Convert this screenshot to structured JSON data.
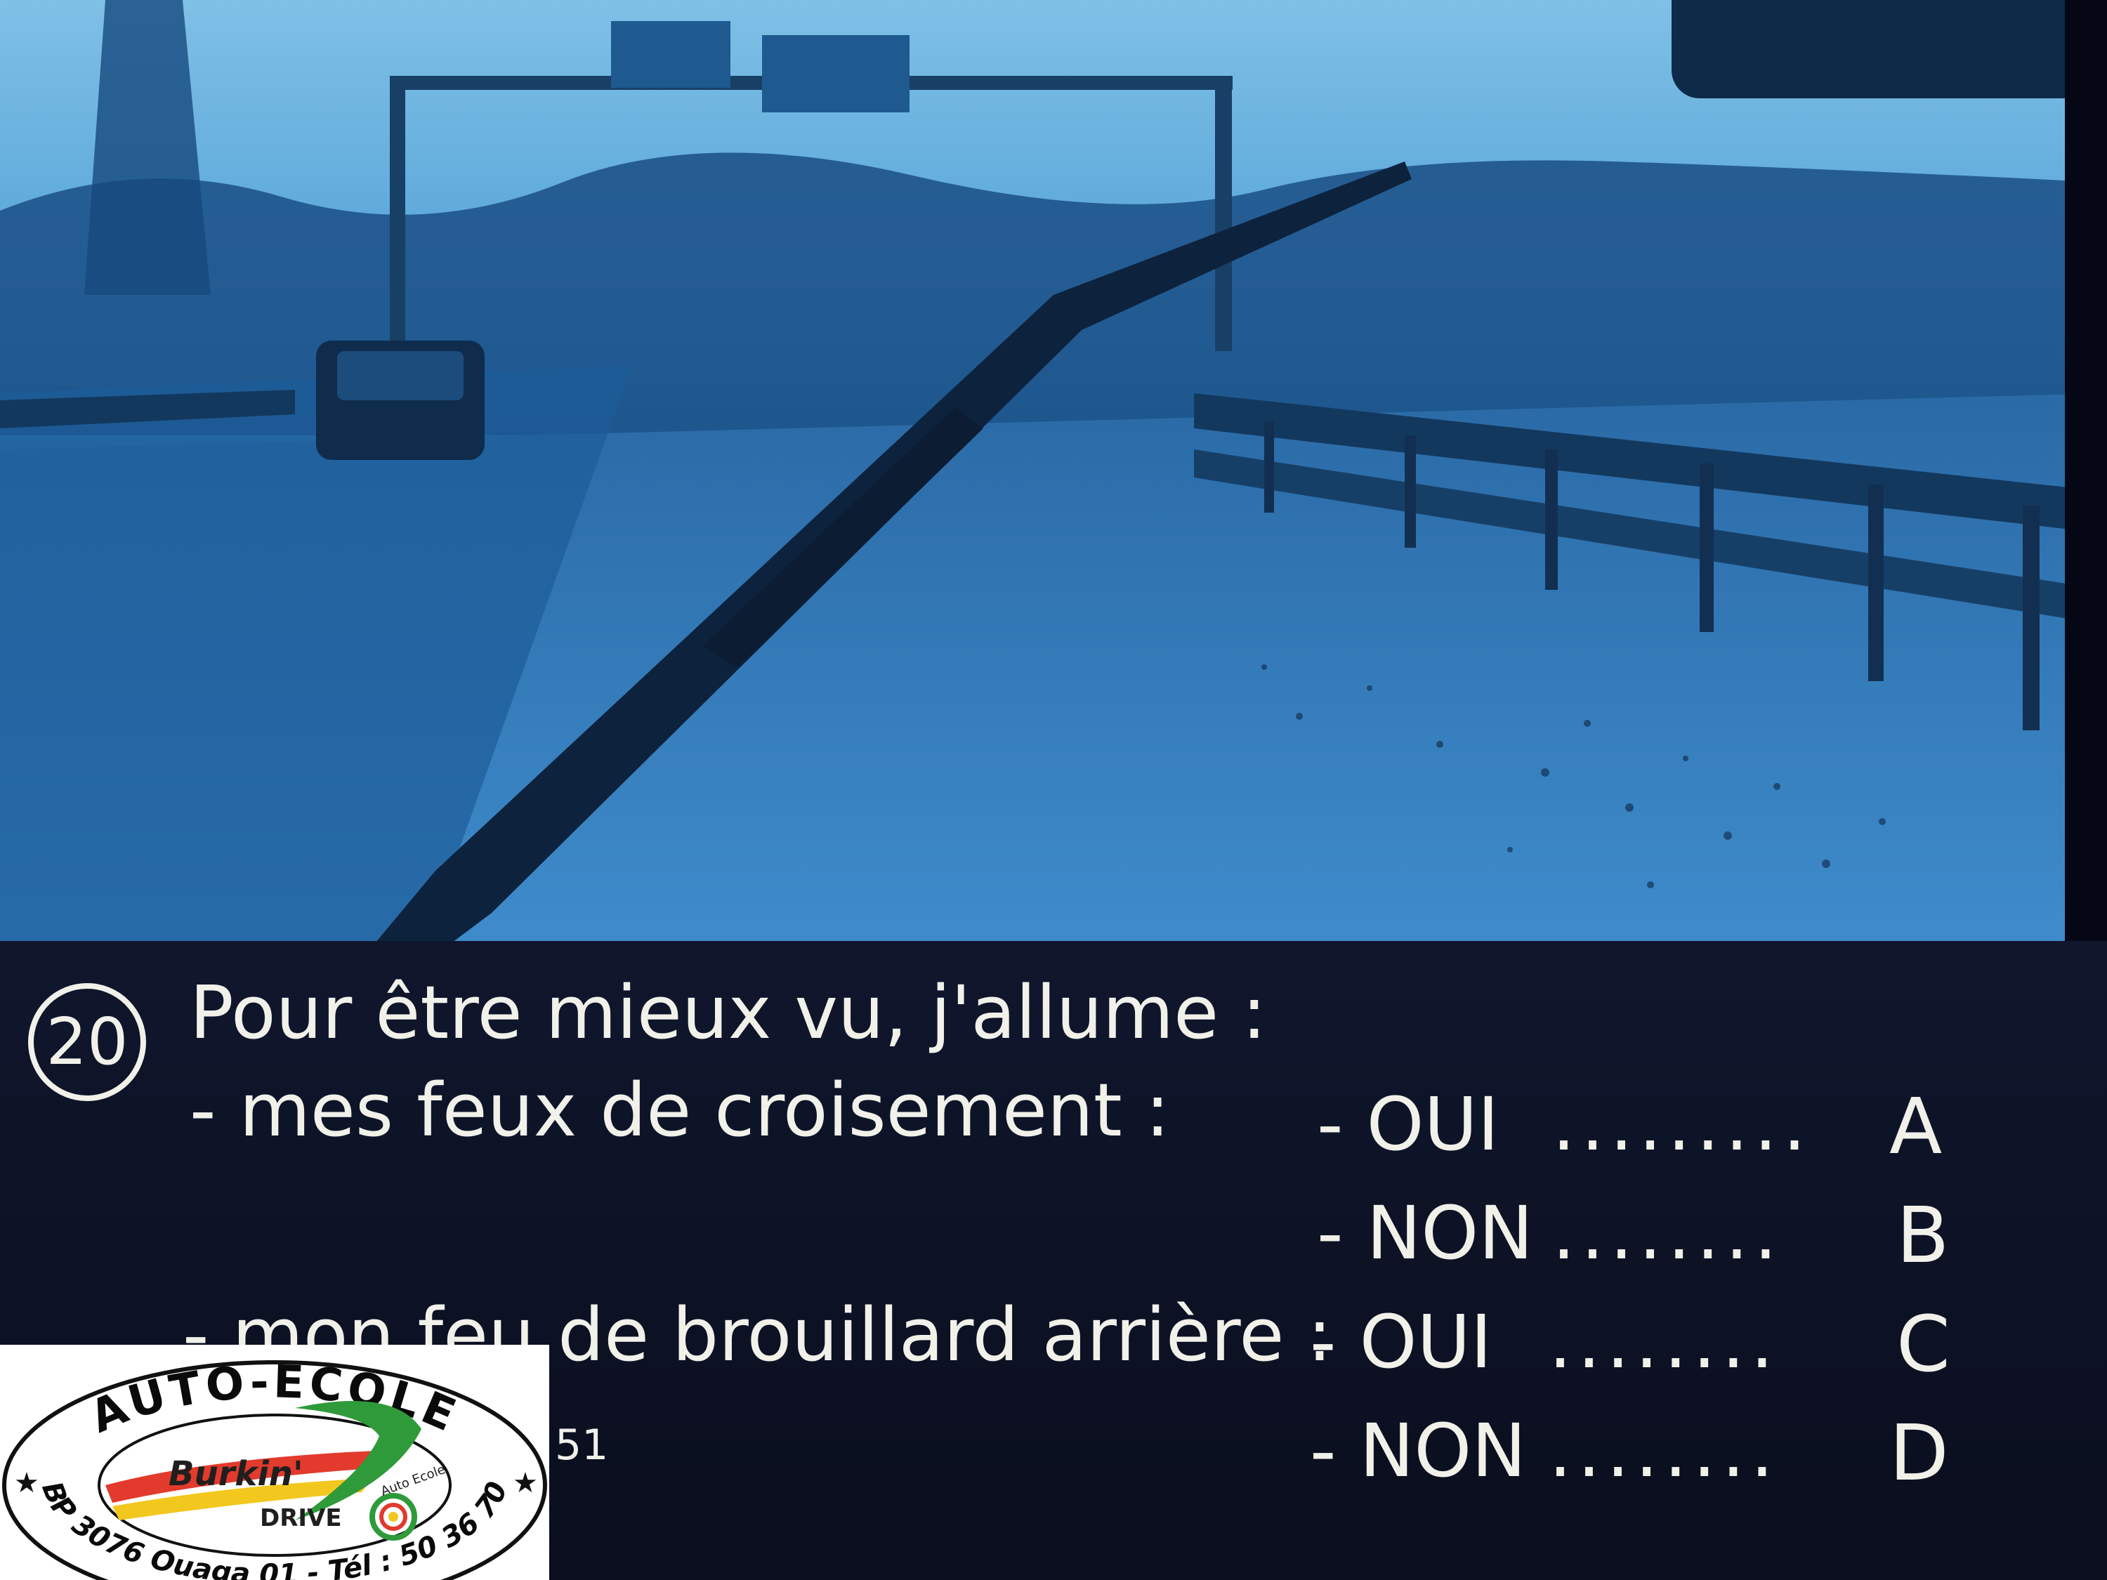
{
  "question": {
    "number": "20",
    "prompt": "Pour être mieux vu, j'allume :",
    "items": [
      {
        "label": "- mes feux de croisement :",
        "answers": [
          {
            "text": "- OUI",
            "dots": ".........",
            "letter": "A"
          },
          {
            "text": "- NON",
            "dots": "........",
            "letter": "B"
          }
        ]
      },
      {
        "label": "- mon feu de brouillard arrière :",
        "answers": [
          {
            "text": "- OUI",
            "dots": "........",
            "letter": "C"
          },
          {
            "text": "- NON",
            "dots": "........",
            "letter": "D"
          }
        ]
      }
    ],
    "reference": "51"
  },
  "logo": {
    "top_text": "AUTO-ECOLE",
    "name_main": "Burkin'",
    "name_sub": "DRIVE",
    "small_text": "Auto Ecole",
    "bottom_text": "01 BP 3076 Ouaga 01 - Tél : 50 36 70 88"
  },
  "colors": {
    "photo_tint": "#1f5f9e",
    "text": "#f1f1ea",
    "panel": "#0c1124"
  }
}
